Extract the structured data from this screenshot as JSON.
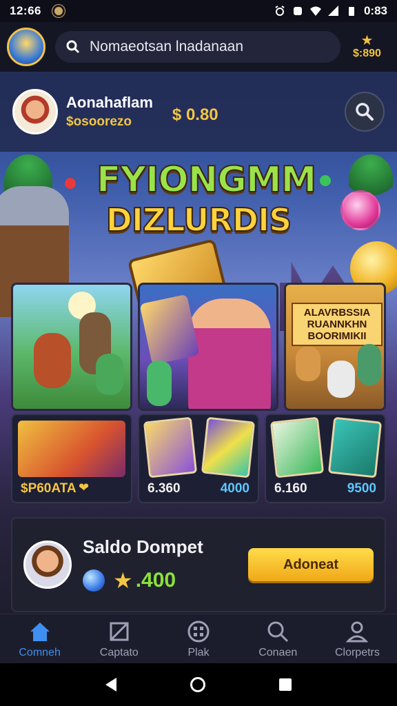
{
  "status_bar": {
    "time": "12:66",
    "battery": "0:83"
  },
  "header": {
    "logo_text": "",
    "search_text": "Nomaeotsan lnadanaan",
    "coins": "$:890"
  },
  "profile": {
    "name": "Aonahaflam",
    "sub": "$osoorezo",
    "coins": "$ 0.80"
  },
  "banner": {
    "title_line1": "FYIONGMM",
    "title_line2": "DIZLURDIS",
    "promo_text": "ALAVRBSSIA RUANNKHN BOORIMIKII"
  },
  "shop": [
    {
      "price": "$P60ATA",
      "price2": ""
    },
    {
      "price": "6.360",
      "price2": "4000"
    },
    {
      "price": "6.160",
      "price2": "9500"
    }
  ],
  "wallet": {
    "title": "Saldo Dompet",
    "balance": ".400",
    "button_label": "Adoneat"
  },
  "nav": [
    {
      "label": "Comneh",
      "icon": "home-icon",
      "active": true
    },
    {
      "label": "Captato",
      "icon": "crop-icon",
      "active": false
    },
    {
      "label": "Plak",
      "icon": "gamepad-icon",
      "active": false
    },
    {
      "label": "Conaen",
      "icon": "search-icon",
      "active": false
    },
    {
      "label": "Clorpetrs",
      "icon": "profile-icon",
      "active": false
    }
  ],
  "colors": {
    "accent_gold": "#f4c542",
    "active_nav": "#3f8ff0",
    "green_balance": "#8ae23a"
  }
}
